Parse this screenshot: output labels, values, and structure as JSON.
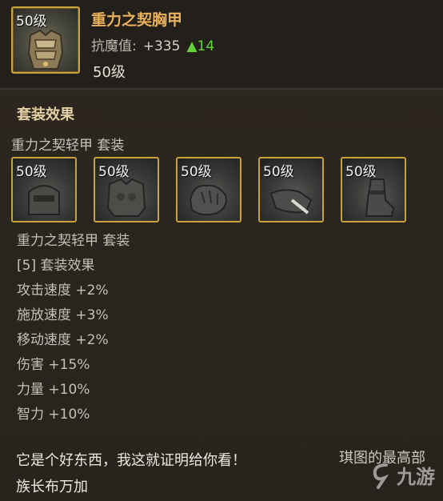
{
  "item": {
    "icon_level": "50级",
    "icon_name": "chest-armor-icon",
    "name": "重力之契胸甲",
    "resist_label": "抗魔值:",
    "resist_value": "+335",
    "resist_change": "▲14",
    "level": "50级"
  },
  "set_section": {
    "title": "套装效果",
    "set_name": "重力之契轻甲 套装",
    "pieces": [
      {
        "level": "50级",
        "icon": "helmet-icon"
      },
      {
        "level": "50级",
        "icon": "chest-icon"
      },
      {
        "level": "50级",
        "icon": "gloves-icon"
      },
      {
        "level": "50级",
        "icon": "belt-icon"
      },
      {
        "level": "50级",
        "icon": "boots-icon"
      }
    ],
    "bonus_set_name": "重力之契轻甲 套装",
    "bonus_header": "[5] 套装效果",
    "bonuses": [
      "攻击速度 +2%",
      "施放速度 +3%",
      "移动速度 +2%",
      "伤害 +15%",
      "力量 +10%",
      "智力 +10%"
    ]
  },
  "flavor": {
    "quote": "它是个好东西，我这就证明给你看！",
    "author": "族长布万加",
    "cut_text": "琪图的最高部"
  },
  "watermark": {
    "text": "九游"
  },
  "colors": {
    "frame_gold": "#c9a23a",
    "name_orange": "#e8b15a",
    "increase_green": "#66d23a"
  }
}
